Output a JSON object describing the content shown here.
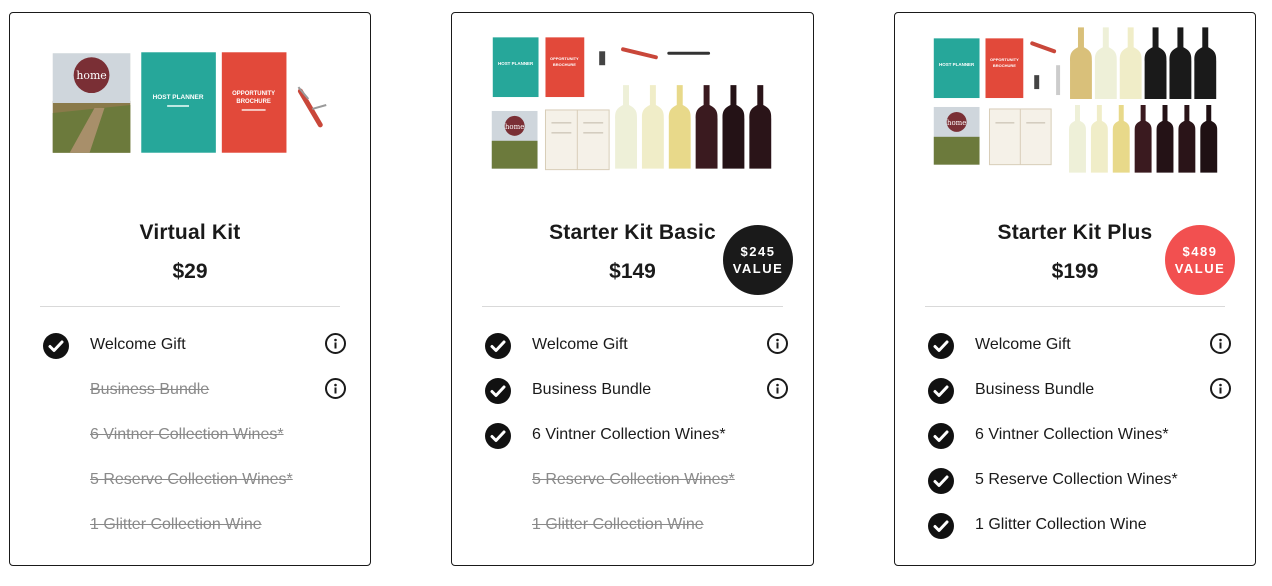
{
  "colors": {
    "border": "#1a1a1a",
    "check": "#111111",
    "disabled_text": "#8a8a8a",
    "badge_dark": "#1a1a1a",
    "badge_red": "#f25050"
  },
  "cards": [
    {
      "title": "Virtual Kit",
      "price": "$29",
      "image": {
        "brochure_home_text": "home",
        "host_planner_text": "HOST PLANNER",
        "opportunity_brochure_text_1": "OPPORTUNITY",
        "opportunity_brochure_text_2": "BROCHURE"
      },
      "badge": null,
      "features": [
        {
          "label": "Welcome Gift",
          "included": true,
          "info": true
        },
        {
          "label": "Business Bundle",
          "included": false,
          "info": true
        },
        {
          "label": "6 Vintner Collection Wines*",
          "included": false,
          "info": false
        },
        {
          "label": "5 Reserve Collection Wines*",
          "included": false,
          "info": false
        },
        {
          "label": "1 Glitter Collection Wine",
          "included": false,
          "info": false
        }
      ]
    },
    {
      "title": "Starter Kit Basic",
      "price": "$149",
      "image": {
        "brochure_home_text": "home",
        "host_planner_text": "HOST PLANNER",
        "opportunity_brochure_text_1": "OPPORTUNITY",
        "opportunity_brochure_text_2": "BROCHURE"
      },
      "badge": {
        "amount": "$245",
        "word": "VALUE",
        "color": "#1a1a1a"
      },
      "features": [
        {
          "label": "Welcome Gift",
          "included": true,
          "info": true
        },
        {
          "label": "Business Bundle",
          "included": true,
          "info": true
        },
        {
          "label": "6 Vintner Collection Wines*",
          "included": true,
          "info": false
        },
        {
          "label": "5 Reserve Collection Wines*",
          "included": false,
          "info": false
        },
        {
          "label": "1 Glitter Collection Wine",
          "included": false,
          "info": false
        }
      ]
    },
    {
      "title": "Starter Kit Plus",
      "price": "$199",
      "image": {
        "brochure_home_text": "home",
        "host_planner_text": "HOST PLANNER",
        "opportunity_brochure_text_1": "OPPORTUNITY",
        "opportunity_brochure_text_2": "BROCHURE"
      },
      "badge": {
        "amount": "$489",
        "word": "VALUE",
        "color": "#f25050"
      },
      "features": [
        {
          "label": "Welcome Gift",
          "included": true,
          "info": true
        },
        {
          "label": "Business Bundle",
          "included": true,
          "info": true
        },
        {
          "label": "6 Vintner Collection Wines*",
          "included": true,
          "info": false
        },
        {
          "label": "5 Reserve Collection Wines*",
          "included": true,
          "info": false
        },
        {
          "label": "1 Glitter Collection Wine",
          "included": true,
          "info": false
        }
      ]
    }
  ]
}
